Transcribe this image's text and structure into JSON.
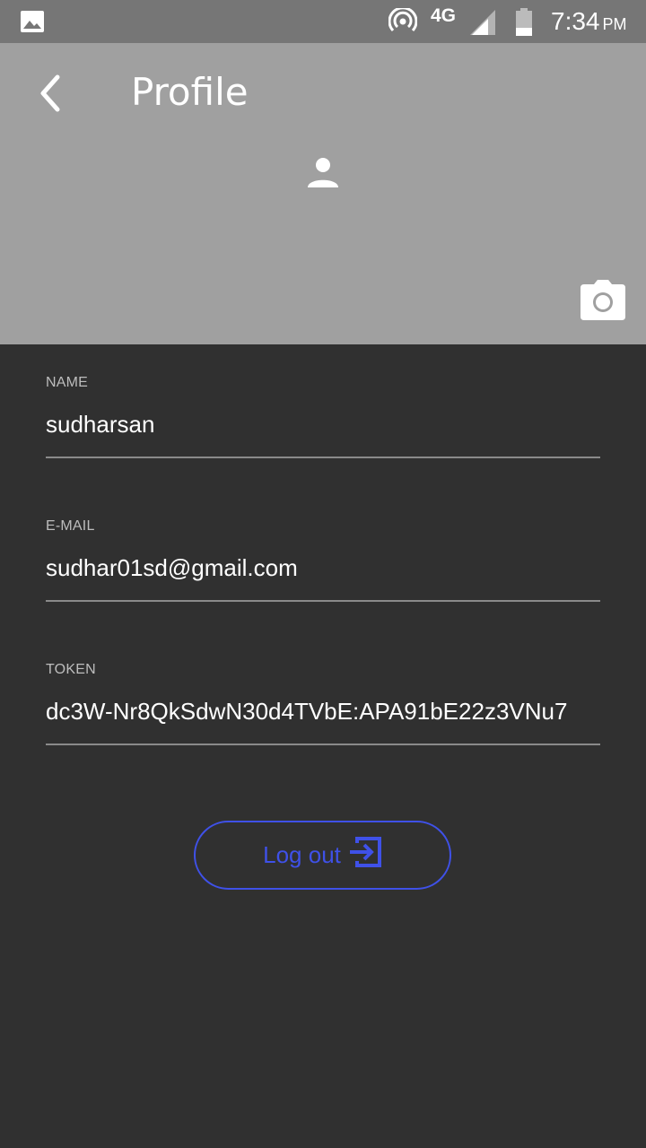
{
  "status_bar": {
    "network": "4G",
    "time": "7:34",
    "ampm": "PM"
  },
  "header": {
    "title": "Profile"
  },
  "fields": {
    "name": {
      "label": "NAME",
      "value": "sudharsan"
    },
    "email": {
      "label": "E-MAIL",
      "value": "sudhar01sd@gmail.com"
    },
    "token": {
      "label": "TOKEN",
      "value": "dc3W-Nr8QkSdwN30d4TVbE:APA91bE22z3VNu7"
    }
  },
  "logout": {
    "label": "Log out"
  },
  "colors": {
    "status_bar": "#767676",
    "header": "#a0a0a0",
    "background": "#303030",
    "accent": "#3f51e8"
  },
  "icons": [
    "image-icon",
    "hotspot-icon",
    "signal-icon",
    "battery-icon",
    "back-arrow-icon",
    "person-icon",
    "camera-icon",
    "logout-icon"
  ]
}
